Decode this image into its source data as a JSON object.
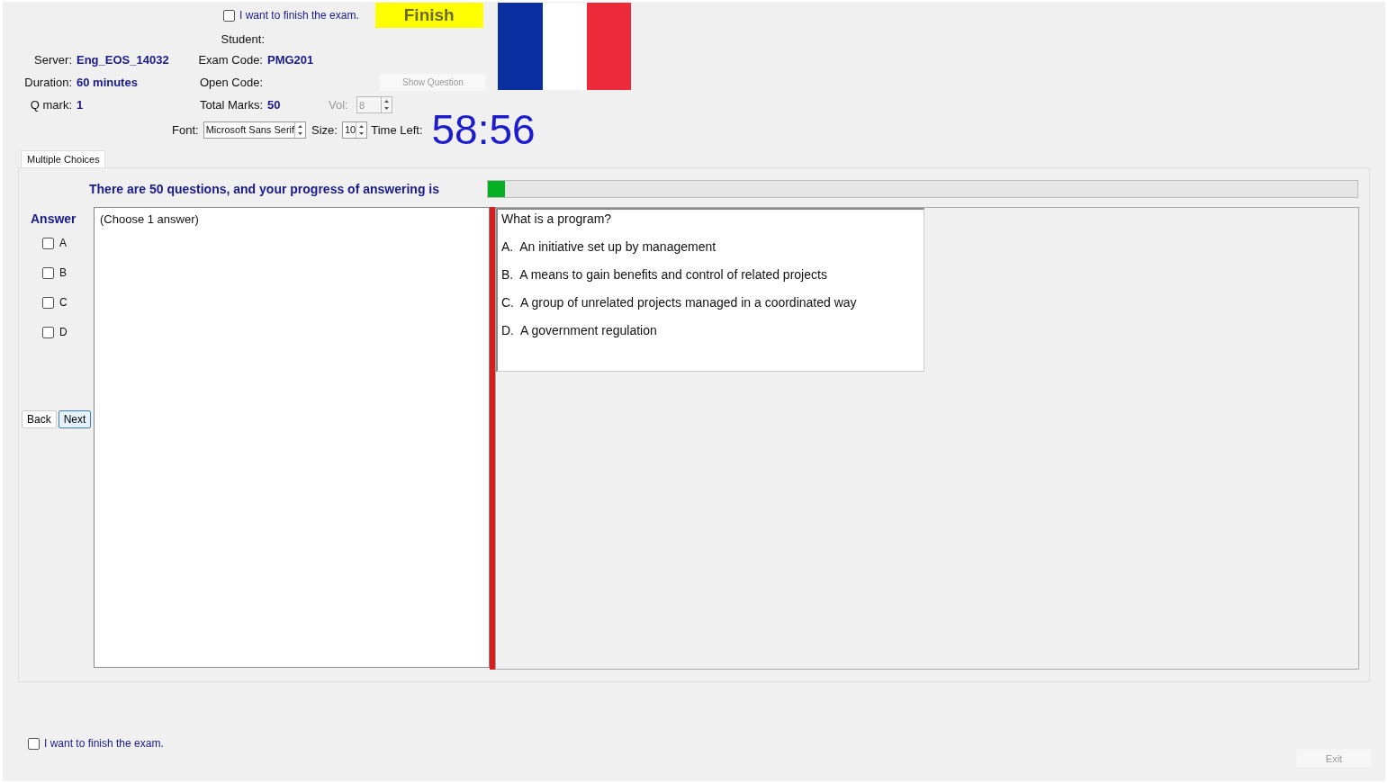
{
  "header": {
    "finish_confirm": {
      "label": "I want to finish the exam.",
      "checked": false
    },
    "finish_button": {
      "label": "Finish"
    },
    "student_label": "Student:",
    "info_rows": [
      {
        "left": {
          "label": "Server:",
          "value": "Eng_EOS_14032"
        },
        "right": {
          "label": "Exam Code:",
          "value": "PMG201"
        }
      },
      {
        "left": {
          "label": "Duration:",
          "value": "60 minutes"
        },
        "right": {
          "label": "Open Code:",
          "kind": "field"
        }
      },
      {
        "left": {
          "label": "Q mark:",
          "value": "1"
        },
        "right": {
          "label": "Total Marks:",
          "value": "50"
        }
      }
    ],
    "show_question_button": {
      "label": "Show Question",
      "disabled": true
    },
    "volume": {
      "label": "Vol:",
      "value": "8",
      "disabled": true
    },
    "font": {
      "label": "Font:",
      "value": "Microsoft Sans Serif"
    },
    "size": {
      "label": "Size:",
      "value": "10"
    },
    "time_left": {
      "label": "Time Left:",
      "value": "58:56"
    }
  },
  "tabs": [
    {
      "label": "Multiple Choices",
      "selected": true
    }
  ],
  "progress": {
    "text": "There are 50 questions, and your progress of answering is",
    "level": 0.02
  },
  "answer": {
    "title": "Answer",
    "options": [
      {
        "letter": "A",
        "checked": false
      },
      {
        "letter": "B",
        "checked": false
      },
      {
        "letter": "C",
        "checked": false
      },
      {
        "letter": "D",
        "checked": false
      }
    ]
  },
  "nav_buttons": [
    {
      "label": "Back",
      "focused": false
    },
    {
      "label": "Next",
      "focused": true
    }
  ],
  "answer_note": "(Choose 1 answer)",
  "question": {
    "text": "What is a program?",
    "choices": [
      {
        "label": "A.",
        "text": "An initiative set up by management"
      },
      {
        "label": "B.",
        "text": "A means to gain benefits and control of related projects"
      },
      {
        "label": "C.",
        "text": "A group of unrelated projects managed in a coordinated way"
      },
      {
        "label": "D.",
        "text": "A government regulation"
      }
    ]
  },
  "footer": {
    "finish_confirm": {
      "label": "I want to finish the exam.",
      "checked": false
    },
    "exit_button": {
      "label": "Exit",
      "disabled": true
    }
  }
}
